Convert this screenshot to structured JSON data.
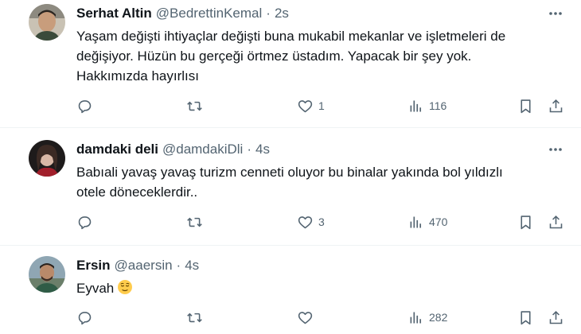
{
  "tweets": [
    {
      "name": "Serhat Altin",
      "handle": "@BedrettinKemal",
      "separator": "·",
      "time": "2s",
      "lines": [
        "Yaşam değişti ihtiyaçlar değişti buna mukabil mekanlar ve işletmeleri de",
        "değişiyor. Hüzün bu gerçeği örtmez üstadım. Yapacak bir şey yok.",
        "Hakkımızda hayırlısı"
      ],
      "replies": "",
      "retweets": "",
      "likes": "1",
      "views": "116"
    },
    {
      "name": "damdaki deli",
      "handle": "@damdakiDli",
      "separator": "·",
      "time": "4s",
      "lines": [
        "Babıali yavaş yavaş turizm cenneti oluyor bu binalar yakında bol yıldızlı",
        "otele döneceklerdir.."
      ],
      "replies": "",
      "retweets": "",
      "likes": "3",
      "views": "470"
    },
    {
      "name": "Ersin",
      "handle": "@aaersin",
      "separator": "·",
      "time": "4s",
      "lines": [
        "Eyvah"
      ],
      "emoji": "relieved-face-emoji",
      "replies": "",
      "retweets": "",
      "likes": "",
      "views": "282"
    }
  ],
  "icons": {
    "more": "more-dots-icon",
    "reply": "reply-icon",
    "retweet": "retweet-icon",
    "like": "heart-icon",
    "views": "views-chart-icon",
    "bookmark": "bookmark-icon",
    "share": "share-icon"
  },
  "colors": {
    "text": "#0f1419",
    "muted": "#536471",
    "divider": "#eff3f4",
    "background": "#ffffff"
  }
}
